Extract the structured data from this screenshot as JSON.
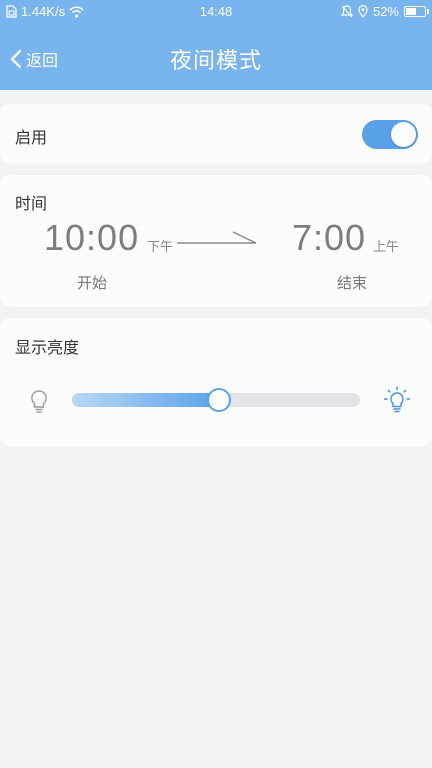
{
  "status_bar": {
    "speed": "1.44K/s",
    "time": "14:48",
    "battery": "52%"
  },
  "app_bar": {
    "back_label": "返回",
    "title": "夜间模式"
  },
  "enable": {
    "label": "启用",
    "on": true
  },
  "time": {
    "label": "时间",
    "start_time": "10:00",
    "start_period": "下午",
    "start_label": "开始",
    "end_time": "7:00",
    "end_period": "上午",
    "end_label": "结束"
  },
  "brightness": {
    "label": "显示亮度",
    "level": 0.51
  },
  "colors": {
    "accent": "#5aa2e8",
    "header": "#78b4ee",
    "background": "#f1f3f5"
  }
}
